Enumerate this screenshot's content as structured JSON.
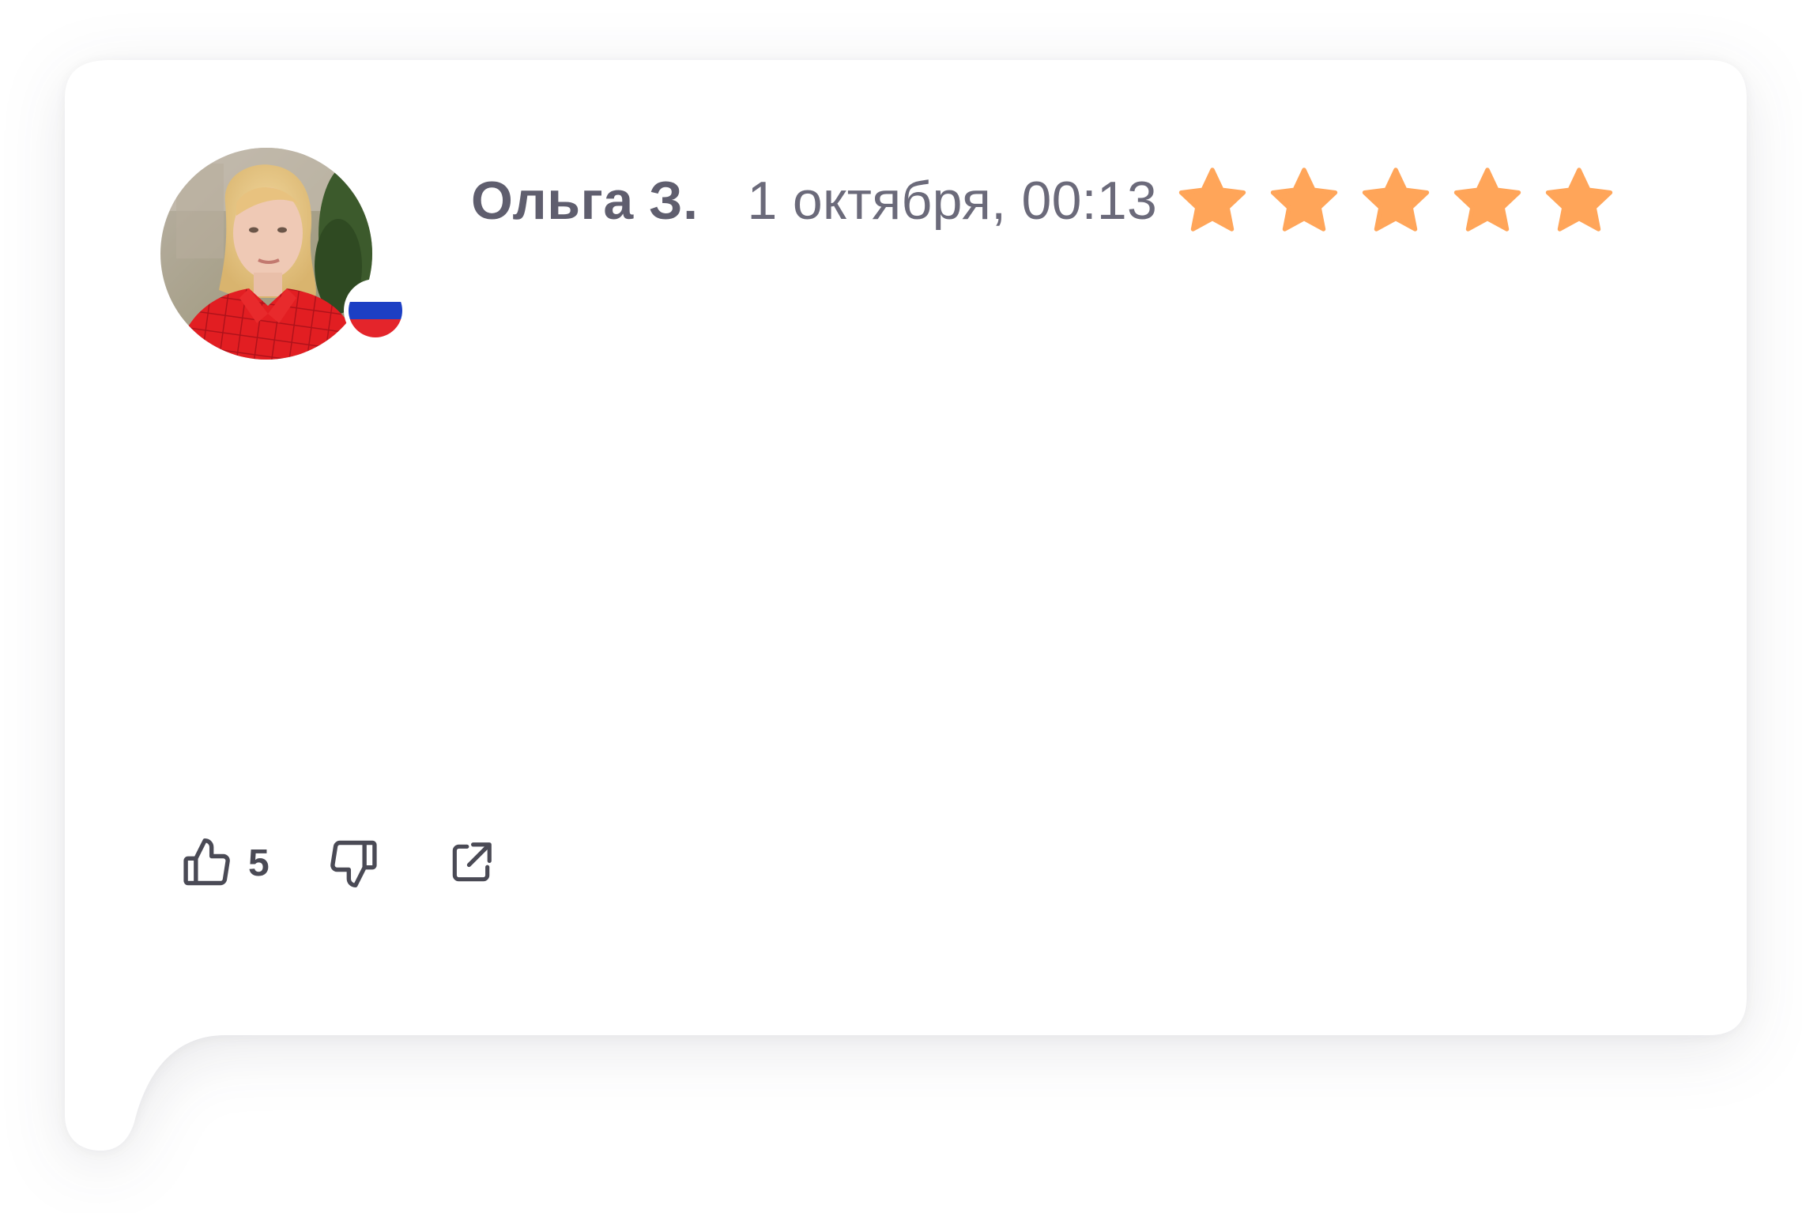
{
  "review": {
    "author": "Ольга З.",
    "date": "1 октября, 00:13",
    "rating": 5,
    "rating_max": 5,
    "country_flag": "russia-flag",
    "likes": "5"
  },
  "icons": {
    "like": "thumbs-up-icon",
    "dislike": "thumbs-down-icon",
    "share": "external-link-icon",
    "star": "star-icon"
  },
  "colors": {
    "star": "#ffa559",
    "text_primary": "#5f5e6e",
    "text_secondary": "#6b6a7a",
    "icon": "#4a4a55",
    "flag_white": "#ffffff",
    "flag_blue": "#1c3fc4",
    "flag_red": "#e4252b"
  }
}
